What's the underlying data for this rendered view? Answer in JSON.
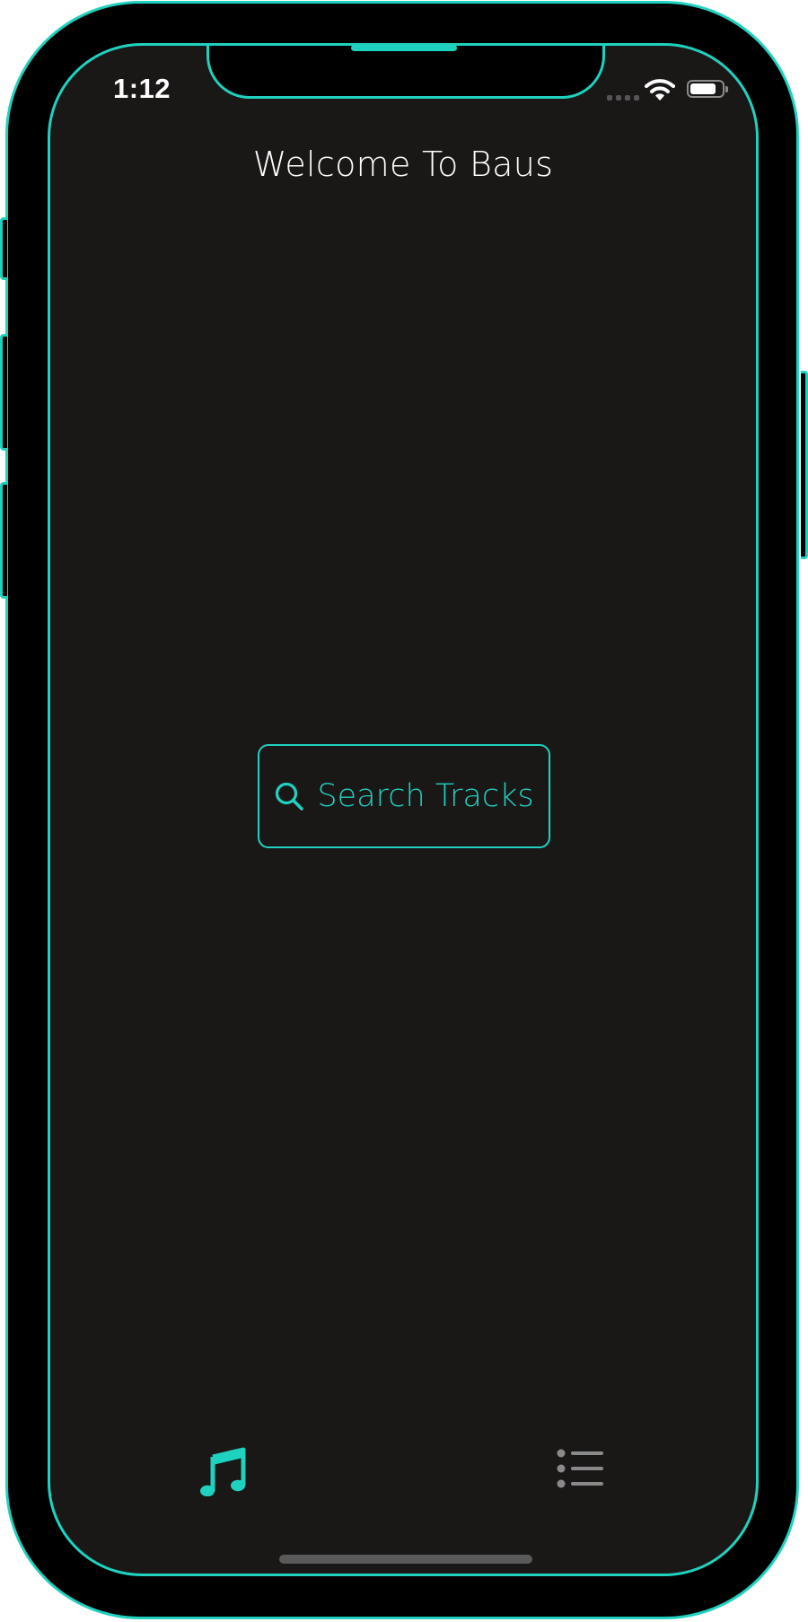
{
  "status_bar": {
    "time": "1:12",
    "wifi_icon": "wifi-icon",
    "battery_icon": "battery-icon",
    "signal_icon": "cellular-signal-icon"
  },
  "header": {
    "title": "Welcome To Baus"
  },
  "main": {
    "search_button": {
      "label": "Search Tracks",
      "icon": "search-icon"
    }
  },
  "tab_bar": {
    "tabs": [
      {
        "name": "music",
        "icon": "music-note-icon",
        "active": true
      },
      {
        "name": "list",
        "icon": "list-icon",
        "active": false
      }
    ]
  },
  "colors": {
    "accent": "#1fd1bf",
    "background": "#1a1717",
    "frame": "#000000",
    "text": "#ffffff",
    "inactive_icon": "#8a8a8a"
  }
}
